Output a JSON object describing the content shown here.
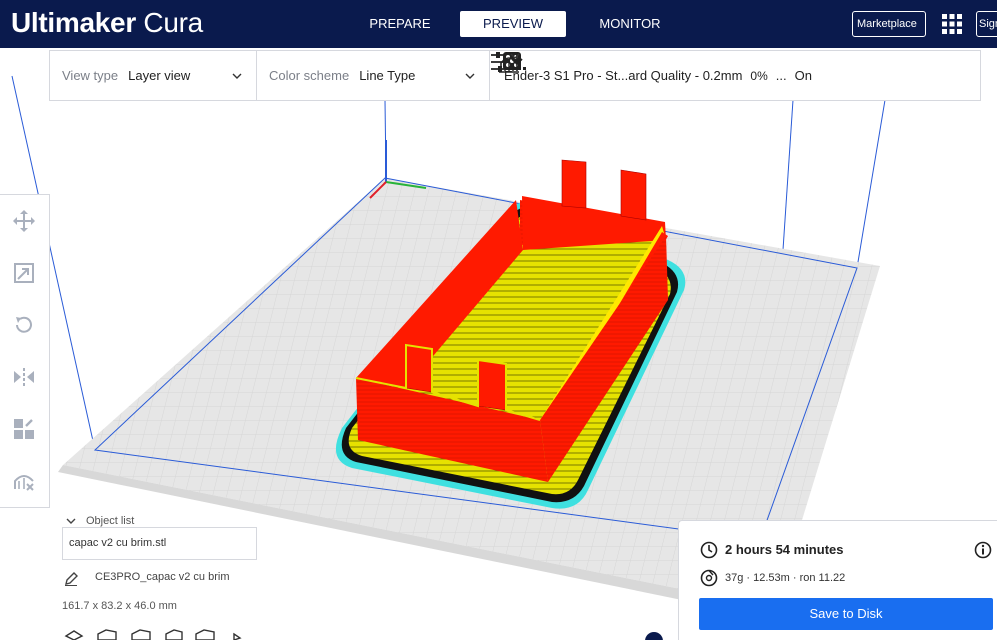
{
  "app": {
    "brand_bold": "Ultimaker",
    "brand_light": "Cura"
  },
  "stages": [
    {
      "label": "PREPARE",
      "active": false
    },
    {
      "label": "PREVIEW",
      "active": true
    },
    {
      "label": "MONITOR",
      "active": false
    }
  ],
  "header_buttons": {
    "marketplace": "Marketplace",
    "signin": "Sign in"
  },
  "toolbar": {
    "view_type_label": "View type",
    "view_type_value": "Layer view",
    "color_scheme_label": "Color scheme",
    "color_scheme_value": "Line Type",
    "print_profile": "Ender-3 S1 Pro - St...ard Quality - 0.2mm",
    "infill": "0%",
    "support": "...",
    "adhesion": "On"
  },
  "left_tools": [
    "move-icon",
    "scale-icon",
    "rotate-icon",
    "mirror-icon",
    "per-model-settings-icon",
    "support-blocker-icon"
  ],
  "object_list": {
    "header": "Object list",
    "file": "capac v2 cu brim.stl",
    "job_name": "CE3PRO_capac v2 cu brim",
    "dimensions": "161.7 x 83.2 x 46.0 mm"
  },
  "print_info": {
    "time": "2 hours 54 minutes",
    "material": "37g · 12.53m · ron 11.22",
    "save_button": "Save to Disk"
  },
  "colors": {
    "header_bg": "#0a1a4d",
    "accent": "#196ef0",
    "wall_red": "#ff1a00",
    "infill_yellow": "#e6e200",
    "skirt_cyan": "#3fe0e0",
    "build_plate": "#e9e9e9"
  }
}
